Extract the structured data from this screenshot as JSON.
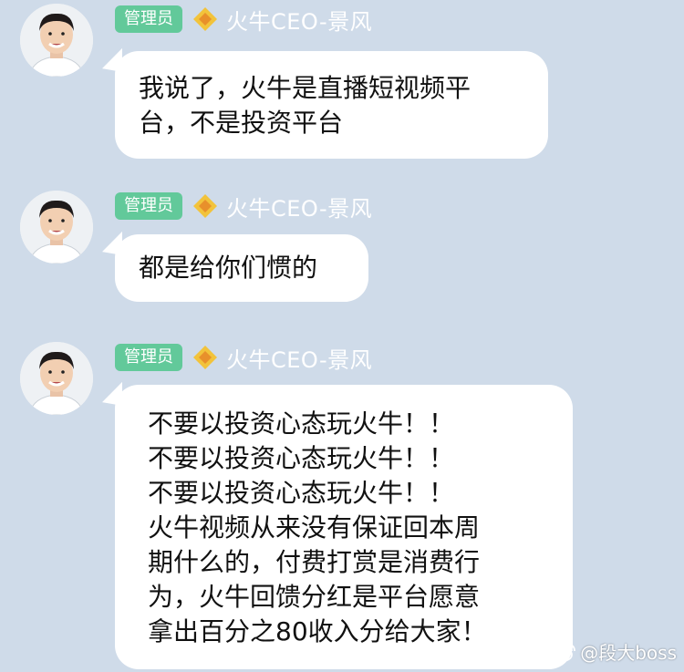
{
  "messages": [
    {
      "role": "管理员",
      "sender": "火牛CEO-景风",
      "lines": [
        "我说了，火牛是直播短视频平",
        "台，不是投资平台"
      ]
    },
    {
      "role": "管理员",
      "sender": "火牛CEO-景风",
      "lines": [
        "都是给你们惯的"
      ]
    },
    {
      "role": "管理员",
      "sender": "火牛CEO-景风",
      "lines": [
        "不要以投资心态玩火牛！！",
        "不要以投资心态玩火牛！！",
        "不要以投资心态玩火牛！！",
        "火牛视频从来没有保证回本周",
        "期什么的，付费打赏是消费行",
        "为，火牛回馈分红是平台愿意",
        "拿出百分之80收入分给大家！"
      ]
    }
  ],
  "watermark": {
    "text": "@段大boss",
    "icon": "weibo-icon"
  },
  "colors": {
    "background": "#cfdbe9",
    "badge": "#62c99a",
    "bubble": "#ffffff",
    "crown": "#f2c33b"
  }
}
